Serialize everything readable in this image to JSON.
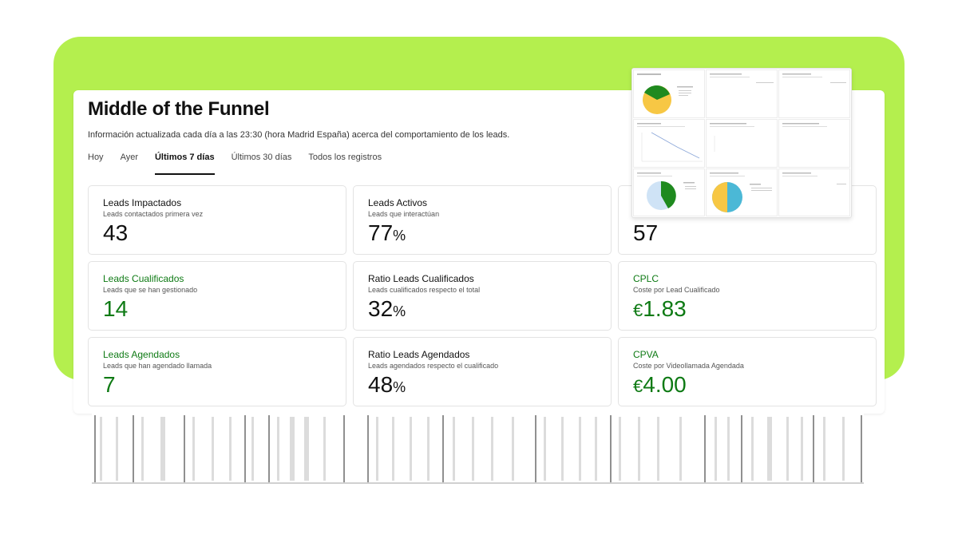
{
  "page": {
    "title": "Middle of the Funnel",
    "subtitle": "Información actualizada cada día a las 23:30 (hora Madrid España) acerca del comportamiento de los leads."
  },
  "tabs": [
    {
      "label": "Hoy",
      "active": false
    },
    {
      "label": "Ayer",
      "active": false
    },
    {
      "label": "Últimos 7 días",
      "active": true
    },
    {
      "label": "Últimos 30 días",
      "active": false
    },
    {
      "label": "Todos los registros",
      "active": false
    }
  ],
  "cards": [
    {
      "title": "Leads Impactados",
      "subtitle": "Leads contactados primera vez",
      "value": "43",
      "unit": "",
      "prefix": "",
      "accent": false
    },
    {
      "title": "Leads Activos",
      "subtitle": "Leads que interactúan",
      "value": "77",
      "unit": "%",
      "prefix": "",
      "accent": false
    },
    {
      "title": "",
      "subtitle": "",
      "value": "57",
      "unit": "",
      "prefix": "",
      "accent": false
    },
    {
      "title": "Leads Cualificados",
      "subtitle": "Leads que se han gestionado",
      "value": "14",
      "unit": "",
      "prefix": "",
      "accent": true
    },
    {
      "title": "Ratio Leads Cualificados",
      "subtitle": "Leads cualificados respecto el total",
      "value": "32",
      "unit": "%",
      "prefix": "",
      "accent": false
    },
    {
      "title": "CPLC",
      "subtitle": "Coste por Lead Cualificado",
      "value": "1.83",
      "unit": "",
      "prefix": "€",
      "accent": true
    },
    {
      "title": "Leads Agendados",
      "subtitle": "Leads que han agendado llamada",
      "value": "7",
      "unit": "",
      "prefix": "",
      "accent": true
    },
    {
      "title": "Ratio Leads Agendados",
      "subtitle": "Leads agendados respecto el cualificado",
      "value": "48",
      "unit": "%",
      "prefix": "",
      "accent": false
    },
    {
      "title": "CPVA",
      "subtitle": "Coste por Videollamada Agendada",
      "value": "4.00",
      "unit": "",
      "prefix": "€",
      "accent": true
    }
  ],
  "colors": {
    "brand_green_bg": "#b4ef4e",
    "accent_green": "#0e7a14",
    "pie_green": "#1f8a1f",
    "pie_yellow": "#f7c744",
    "pie_blue": "#4bb8d6",
    "pie_light_blue": "#cfe3f6"
  }
}
